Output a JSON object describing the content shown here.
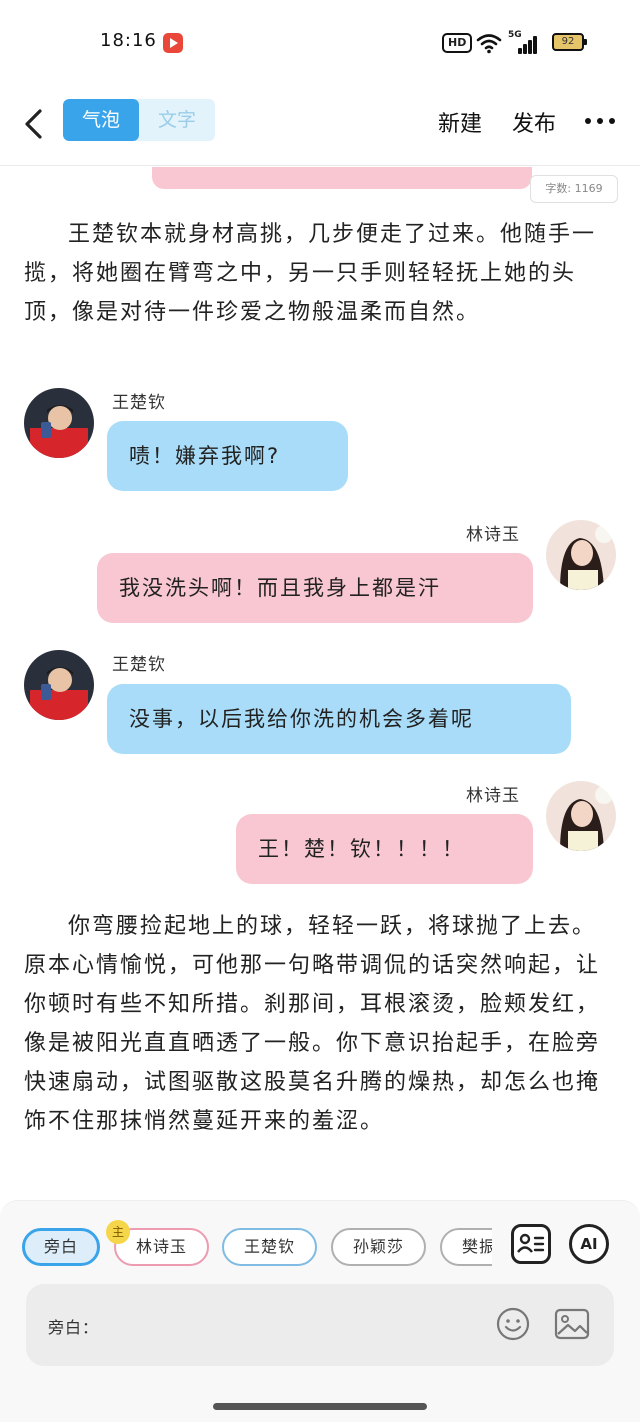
{
  "status_bar": {
    "time": "18:16",
    "hd": "HD",
    "network": "5G",
    "battery": "92"
  },
  "header": {
    "tab_bubble": "气泡",
    "tab_text": "文字",
    "new_label": "新建",
    "publish_label": "发布"
  },
  "content": {
    "word_count": "字数: 1169",
    "narration_1": "王楚钦本就身材高挑，几步便走了过来。他随手一揽，将她圈在臂弯之中，另一只手则轻轻抚上她的头顶，像是对待一件珍爱之物般温柔而自然。",
    "messages": [
      {
        "speaker": "王楚钦",
        "text": "啧！嫌弃我啊?"
      },
      {
        "speaker": "林诗玉",
        "text": "我没洗头啊！而且我身上都是汗"
      },
      {
        "speaker": "王楚钦",
        "text": "没事，以后我给你洗的机会多着呢"
      },
      {
        "speaker": "林诗玉",
        "text": "王！楚！钦！！！！"
      }
    ],
    "narration_2": "你弯腰捡起地上的球，轻轻一跃，将球抛了上去。原本心情愉悦，可他那一句略带调侃的话突然响起，让你顿时有些不知所措。刹那间，耳根滚烫，脸颊发红，像是被阳光直直晒透了一般。你下意识抬起手，在脸旁快速扇动，试图驱散这股莫名升腾的燥热，却怎么也掩饰不住那抹悄然蔓延开来的羞涩。"
  },
  "bottom": {
    "chips": [
      "旁白",
      "林诗玉",
      "王楚钦",
      "孙颖莎",
      "樊振东"
    ],
    "main_badge": "主",
    "ai_label": "AI",
    "input_label": "旁白："
  },
  "colors": {
    "accent": "#3aa4ea",
    "blue_bubble": "#a9dcf8",
    "pink_bubble": "#f8c7d2"
  },
  "icons": [
    "back-icon",
    "more-icon",
    "record-icon",
    "wifi-icon",
    "signal-icon",
    "battery-icon",
    "contact-card-icon",
    "ai-icon",
    "emoji-icon",
    "image-icon"
  ]
}
